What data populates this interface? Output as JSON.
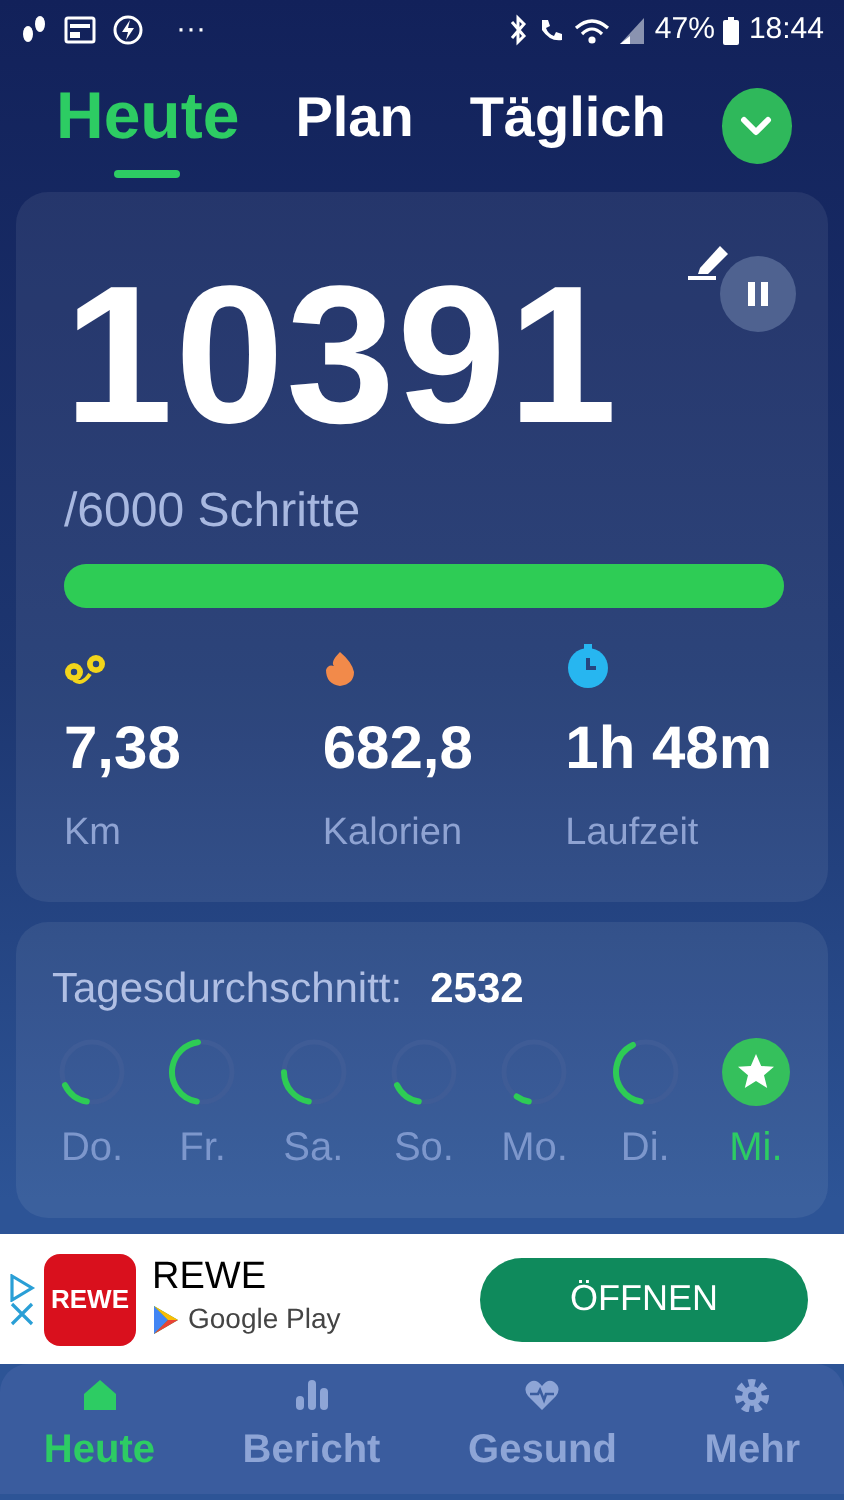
{
  "status_bar": {
    "more": "···",
    "battery": "47%",
    "time": "18:44"
  },
  "tabs": [
    {
      "label": "Heute",
      "selected": true
    },
    {
      "label": "Plan",
      "selected": false
    },
    {
      "label": "Täglich",
      "selected": false
    }
  ],
  "today": {
    "steps": "10391",
    "goal": "/6000 Schritte",
    "level": 1
  },
  "stats": [
    {
      "kind": "distance",
      "value": "7,38",
      "unit": "Km"
    },
    {
      "kind": "calories",
      "value": "682,8",
      "unit": "Kalorien"
    },
    {
      "kind": "time",
      "value": "1h 48m",
      "unit": "Laufzeit"
    }
  ],
  "average": {
    "label": "Tagesdurchschnitt:",
    "value": "2532"
  },
  "days": [
    {
      "label": "Do.",
      "goal_met": false,
      "selected": false
    },
    {
      "label": "Fr.",
      "goal_met": false,
      "selected": false
    },
    {
      "label": "Sa.",
      "goal_met": false,
      "selected": false
    },
    {
      "label": "So.",
      "goal_met": false,
      "selected": false
    },
    {
      "label": "Mo.",
      "goal_met": false,
      "selected": false
    },
    {
      "label": "Di.",
      "goal_met": false,
      "selected": false
    },
    {
      "label": "Mi.",
      "goal_met": true,
      "selected": true
    }
  ],
  "ad": {
    "logo": "REWE",
    "title": "REWE",
    "store": "Google Play",
    "button": "ÖFFNEN"
  },
  "nav": [
    {
      "kind": "home",
      "label": "Heute",
      "selected": true
    },
    {
      "kind": "report",
      "label": "Bericht",
      "selected": false
    },
    {
      "kind": "health",
      "label": "Gesund",
      "selected": false
    },
    {
      "kind": "more",
      "label": "Mehr",
      "selected": false
    }
  ]
}
